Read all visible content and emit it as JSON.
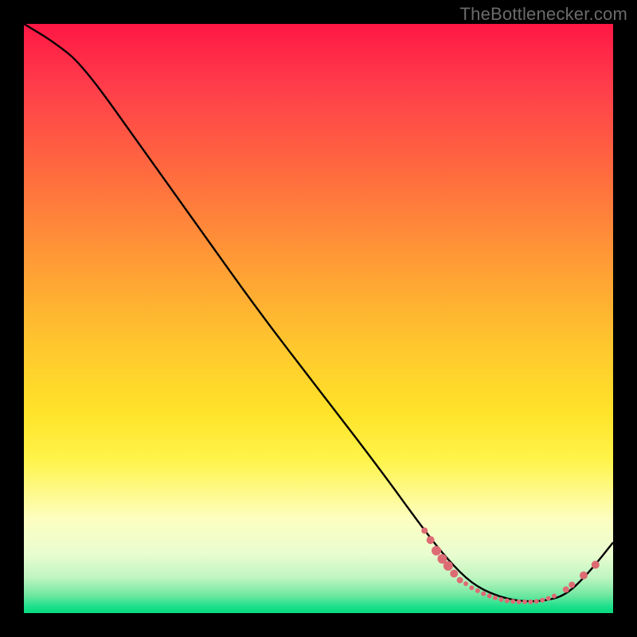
{
  "watermark": "TheBottlenecker.com",
  "chart_data": {
    "type": "line",
    "title": "",
    "xlabel": "",
    "ylabel": "",
    "xlim": [
      0,
      100
    ],
    "ylim": [
      0,
      100
    ],
    "grid": false,
    "series": [
      {
        "name": "curve",
        "color": "#000000",
        "x": [
          0,
          5,
          10,
          20,
          30,
          40,
          50,
          60,
          68,
          72,
          76,
          80,
          84,
          88,
          92,
          96,
          100
        ],
        "y": [
          100,
          97,
          93,
          79,
          65,
          51,
          38,
          25,
          14,
          9,
          5,
          3,
          2,
          2,
          3,
          7,
          12
        ]
      }
    ],
    "markers": {
      "name": "optimal-range",
      "color": "#dd6b74",
      "points": [
        {
          "x": 68,
          "y": 14,
          "r": 4
        },
        {
          "x": 69,
          "y": 12.4,
          "r": 5
        },
        {
          "x": 70,
          "y": 10.6,
          "r": 6
        },
        {
          "x": 71,
          "y": 9.2,
          "r": 6
        },
        {
          "x": 72,
          "y": 8.0,
          "r": 6
        },
        {
          "x": 73,
          "y": 6.7,
          "r": 5
        },
        {
          "x": 74,
          "y": 5.6,
          "r": 4
        },
        {
          "x": 75,
          "y": 5.0,
          "r": 3
        },
        {
          "x": 76,
          "y": 4.3,
          "r": 3
        },
        {
          "x": 77,
          "y": 3.8,
          "r": 3
        },
        {
          "x": 78,
          "y": 3.3,
          "r": 3
        },
        {
          "x": 79,
          "y": 2.9,
          "r": 3
        },
        {
          "x": 80,
          "y": 2.6,
          "r": 3
        },
        {
          "x": 81,
          "y": 2.3,
          "r": 3
        },
        {
          "x": 82,
          "y": 2.1,
          "r": 3
        },
        {
          "x": 83,
          "y": 2.0,
          "r": 3
        },
        {
          "x": 84,
          "y": 1.9,
          "r": 3
        },
        {
          "x": 85,
          "y": 1.9,
          "r": 3
        },
        {
          "x": 86,
          "y": 1.9,
          "r": 3
        },
        {
          "x": 87,
          "y": 2.0,
          "r": 3
        },
        {
          "x": 88,
          "y": 2.2,
          "r": 3
        },
        {
          "x": 89,
          "y": 2.5,
          "r": 3
        },
        {
          "x": 90,
          "y": 2.9,
          "r": 3
        },
        {
          "x": 92,
          "y": 4.0,
          "r": 4
        },
        {
          "x": 93,
          "y": 4.8,
          "r": 4
        },
        {
          "x": 95,
          "y": 6.4,
          "r": 5
        },
        {
          "x": 97,
          "y": 8.2,
          "r": 5
        }
      ]
    }
  }
}
